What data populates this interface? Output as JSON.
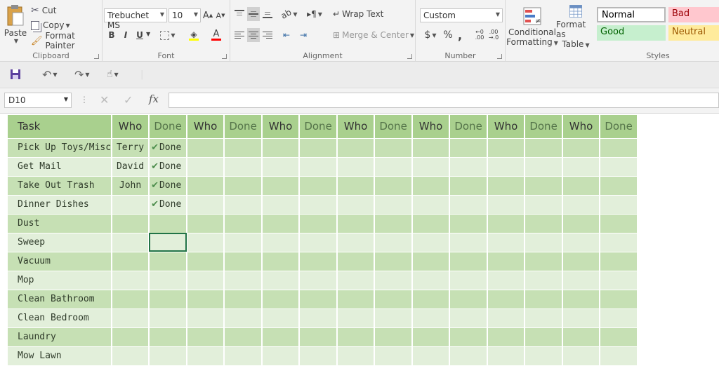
{
  "clipboard": {
    "paste_label": "Paste",
    "cut_label": "Cut",
    "copy_label": "Copy",
    "format_painter_label": "Format Painter",
    "group_label": "Clipboard"
  },
  "font": {
    "family": "Trebuchet MS",
    "size": "10",
    "bold": "B",
    "italic": "I",
    "underline": "U",
    "group_label": "Font"
  },
  "alignment": {
    "wrap_text_label": "Wrap Text",
    "merge_center_label": "Merge & Center",
    "group_label": "Alignment"
  },
  "number": {
    "format": "Custom",
    "currency": "$",
    "percent": "%",
    "comma": ",",
    "group_label": "Number"
  },
  "styles": {
    "conditional_formatting_line1": "Conditional",
    "conditional_formatting_line2": "Formatting",
    "format_as_table_line1": "Format as",
    "format_as_table_line2": "Table",
    "normal": "Normal",
    "bad": "Bad",
    "good": "Good",
    "neutral": "Neutral",
    "group_label": "Styles",
    "colors": {
      "bad_bg": "#ffc7ce",
      "bad_fg": "#9c0006",
      "good_bg": "#c6efce",
      "good_fg": "#006100",
      "neutral_bg": "#ffeb9c",
      "neutral_fg": "#9c5700"
    }
  },
  "formula_bar": {
    "name_box": "D10",
    "fx_label": "fx",
    "content": ""
  },
  "sheet": {
    "headers": [
      "Task",
      "Who",
      "Done",
      "Who",
      "Done",
      "Who",
      "Done",
      "Who",
      "Done",
      "Who",
      "Done",
      "Who",
      "Done",
      "Who",
      "Done"
    ],
    "rows": [
      {
        "task": "Pick Up Toys/Misc",
        "who": "Terry",
        "done": "Done"
      },
      {
        "task": "Get Mail",
        "who": "David",
        "done": "Done"
      },
      {
        "task": "Take Out Trash",
        "who": "John",
        "done": "Done"
      },
      {
        "task": "Dinner Dishes",
        "who": "",
        "done": "Done"
      },
      {
        "task": "Dust",
        "who": "",
        "done": ""
      },
      {
        "task": "Sweep",
        "who": "",
        "done": ""
      },
      {
        "task": "Vacuum",
        "who": "",
        "done": ""
      },
      {
        "task": "Mop",
        "who": "",
        "done": ""
      },
      {
        "task": "Clean Bathroom",
        "who": "",
        "done": ""
      },
      {
        "task": "Clean Bedroom",
        "who": "",
        "done": ""
      },
      {
        "task": "Laundry",
        "who": "",
        "done": ""
      },
      {
        "task": "Mow Lawn",
        "who": "",
        "done": ""
      }
    ],
    "selected_cell": "D10",
    "colors": {
      "header": "#a9d08e",
      "band_dark": "#c6e0b4",
      "band_light": "#e2efda",
      "selection": "#217346"
    }
  }
}
